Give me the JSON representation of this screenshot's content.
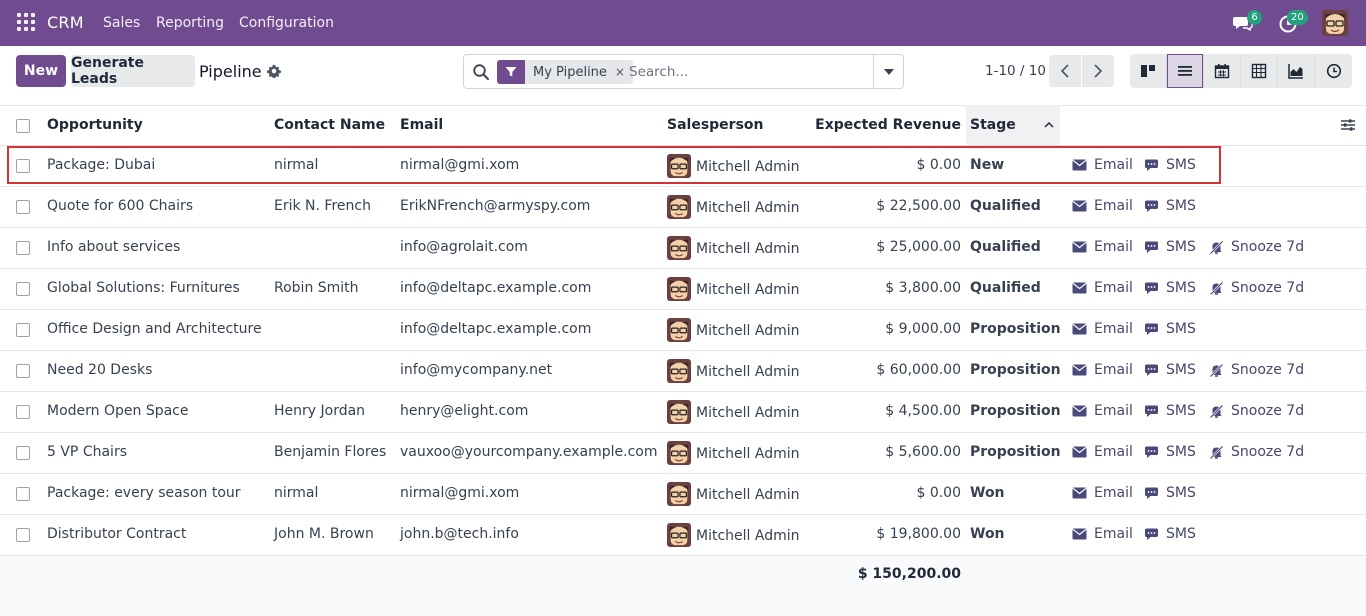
{
  "topbar": {
    "app_name": "CRM",
    "menu": [
      "Sales",
      "Reporting",
      "Configuration"
    ],
    "messages_count": "6",
    "activities_count": "20",
    "badge_color": "#23a17b",
    "bar_color": "#714b8f"
  },
  "control": {
    "new_label": "New",
    "generate_label": "Generate Leads",
    "title": "Pipeline",
    "facet_label": "My Pipeline",
    "facet_remove": "×",
    "search_placeholder": "Search...",
    "pager": "1-10 / 10",
    "views": [
      "kanban-icon",
      "list-icon",
      "calendar-icon",
      "pivot-icon",
      "graph-icon",
      "activity-icon"
    ],
    "active_view": "list-icon"
  },
  "table": {
    "columns": {
      "opportunity": "Opportunity",
      "contact": "Contact Name",
      "email": "Email",
      "salesperson": "Salesperson",
      "revenue": "Expected Revenue",
      "stage": "Stage"
    },
    "action_labels": {
      "email": "Email",
      "sms": "SMS",
      "snooze": "Snooze 7d"
    },
    "rows": [
      {
        "opportunity": "Package: Dubai",
        "contact": "nirmal",
        "email": "nirmal@gmi.xom",
        "salesperson": "Mitchell Admin",
        "revenue": "$ 0.00",
        "stage": "New",
        "snooze": false
      },
      {
        "opportunity": "Quote for 600 Chairs",
        "contact": "Erik N. French",
        "email": "ErikNFrench@armyspy.com",
        "salesperson": "Mitchell Admin",
        "revenue": "$ 22,500.00",
        "stage": "Qualified",
        "snooze": false
      },
      {
        "opportunity": "Info about services",
        "contact": "",
        "email": "info@agrolait.com",
        "salesperson": "Mitchell Admin",
        "revenue": "$ 25,000.00",
        "stage": "Qualified",
        "snooze": true
      },
      {
        "opportunity": "Global Solutions: Furnitures",
        "contact": "Robin Smith",
        "email": "info@deltapc.example.com",
        "salesperson": "Mitchell Admin",
        "revenue": "$ 3,800.00",
        "stage": "Qualified",
        "snooze": true
      },
      {
        "opportunity": "Office Design and Architecture",
        "contact": "",
        "email": "info@deltapc.example.com",
        "salesperson": "Mitchell Admin",
        "revenue": "$ 9,000.00",
        "stage": "Proposition",
        "snooze": false
      },
      {
        "opportunity": "Need 20 Desks",
        "contact": "",
        "email": "info@mycompany.net",
        "salesperson": "Mitchell Admin",
        "revenue": "$ 60,000.00",
        "stage": "Proposition",
        "snooze": true
      },
      {
        "opportunity": "Modern Open Space",
        "contact": "Henry Jordan",
        "email": "henry@elight.com",
        "salesperson": "Mitchell Admin",
        "revenue": "$ 4,500.00",
        "stage": "Proposition",
        "snooze": true
      },
      {
        "opportunity": "5 VP Chairs",
        "contact": "Benjamin Flores",
        "email": "vauxoo@yourcompany.example.com",
        "salesperson": "Mitchell Admin",
        "revenue": "$ 5,600.00",
        "stage": "Proposition",
        "snooze": true
      },
      {
        "opportunity": "Package: every season tour",
        "contact": "nirmal",
        "email": "nirmal@gmi.xom",
        "salesperson": "Mitchell Admin",
        "revenue": "$ 0.00",
        "stage": "Won",
        "snooze": false
      },
      {
        "opportunity": "Distributor Contract",
        "contact": "John M. Brown",
        "email": "john.b@tech.info",
        "salesperson": "Mitchell Admin",
        "revenue": "$ 19,800.00",
        "stage": "Won",
        "snooze": false
      }
    ],
    "total_revenue": "$ 150,200.00"
  }
}
